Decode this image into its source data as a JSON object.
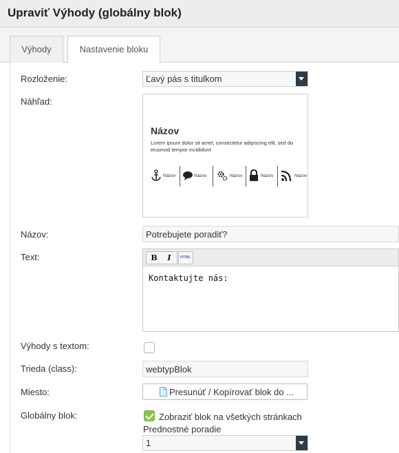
{
  "window": {
    "title": "Upraviť Výhody (globálny blok)"
  },
  "tabs": [
    {
      "label": "Výhody",
      "active": false
    },
    {
      "label": "Nastavenie bloku",
      "active": true
    }
  ],
  "form": {
    "layout": {
      "label": "Rozloženie:",
      "value": "Ľavý pás s titulkom"
    },
    "preview": {
      "label": "Náhľad:",
      "title": "Názov",
      "text": "Lorem ipsum dolor sit amet, consectetur adipiscing elit, sed do eiusmod tempor incididunt",
      "items": [
        {
          "icon": "anchor-icon",
          "label": "Názov"
        },
        {
          "icon": "speech-bubble-icon",
          "label": "Názov"
        },
        {
          "icon": "gears-icon",
          "label": "Názov"
        },
        {
          "icon": "lock-icon",
          "label": "Názov"
        },
        {
          "icon": "rss-icon",
          "label": "Názov"
        }
      ]
    },
    "name": {
      "label": "Názov:",
      "value": "Potrebujete poradiť?"
    },
    "text": {
      "label": "Text:",
      "toolbar": {
        "bold": "B",
        "italic": "I",
        "html": "HTML"
      },
      "content": "Kontaktujte nás:"
    },
    "benefits_with_text": {
      "label": "Výhody s textom:",
      "checked": false
    },
    "css_class": {
      "label": "Trieda (class):",
      "value": "webtypBlok"
    },
    "place": {
      "label": "Miesto:",
      "button_label": "Presunúť / Kopírovať blok do ..."
    },
    "global_block": {
      "label": "Globálny blok:",
      "show_all_label": "Zobraziť blok na všetkých stránkach",
      "show_all_checked": true,
      "priority_label": "Prednostné poradie",
      "priority_value": "1"
    }
  },
  "colors": {
    "accent_green": "#8bc34a",
    "select_arrow_bg": "#2f3a45",
    "header_bg": "#ededed"
  }
}
